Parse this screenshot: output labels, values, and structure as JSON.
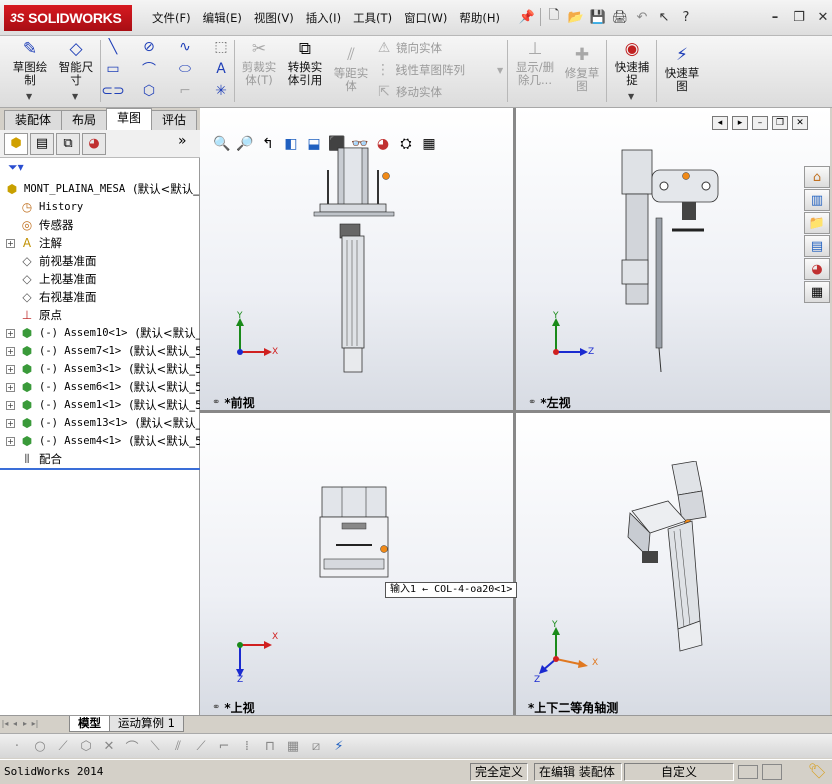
{
  "app": {
    "logo": "SOLIDWORKS",
    "logo_prefix": "3S"
  },
  "menu": [
    "文件(F)",
    "编辑(E)",
    "视图(V)",
    "插入(I)",
    "工具(T)",
    "窗口(W)",
    "帮助(H)"
  ],
  "toolbar": {
    "help_label": "?"
  },
  "command_manager": {
    "sketch": "草图绘\n制",
    "smart_dim": "智能尺\n寸",
    "trim": "剪裁实\n体(T)",
    "convert": "转换实\n体引用",
    "offset": "等距实\n体",
    "mirror": "镜向实体",
    "linear_pattern": "线性草图阵列",
    "move": "移动实体",
    "show_delete": "显示/删\n除几...",
    "repair": "修复草\n图",
    "quick_snap": "快速捕\n捉",
    "rapid_sketch": "快速草\n图"
  },
  "cm_tabs": [
    {
      "label": "装配体",
      "active": false
    },
    {
      "label": "布局",
      "active": false
    },
    {
      "label": "草图",
      "active": true
    },
    {
      "label": "评估",
      "active": false
    }
  ],
  "feature_tree": {
    "root": "MONT_PLAINA_MESA",
    "root_config": "(默认<默认_",
    "items": [
      {
        "label": "History",
        "icon": "history-icon",
        "expand": false,
        "mono": true
      },
      {
        "label": "传感器",
        "icon": "sensor-icon",
        "expand": false
      },
      {
        "label": "注解",
        "icon": "annotation-icon",
        "expand": true
      },
      {
        "label": "前视基准面",
        "icon": "plane-icon",
        "expand": false
      },
      {
        "label": "上视基准面",
        "icon": "plane-icon",
        "expand": false
      },
      {
        "label": "右视基准面",
        "icon": "plane-icon",
        "expand": false
      },
      {
        "label": "原点",
        "icon": "origin-icon",
        "expand": false
      },
      {
        "label": "(-) Assem10<1>",
        "config": "(默认<默认_",
        "icon": "assembly-icon",
        "expand": true,
        "mono": true
      },
      {
        "label": "(-) Assem7<1>",
        "config": "(默认<默认_5",
        "icon": "assembly-icon",
        "expand": true,
        "mono": true
      },
      {
        "label": "(-) Assem3<1>",
        "config": "(默认<默认_5",
        "icon": "assembly-icon",
        "expand": true,
        "mono": true
      },
      {
        "label": "(-) Assem6<1>",
        "config": "(默认<默认_5",
        "icon": "assembly-icon",
        "expand": true,
        "mono": true
      },
      {
        "label": "(-) Assem1<1>",
        "config": "(默认<默认_5",
        "icon": "assembly-icon",
        "expand": true,
        "mono": true
      },
      {
        "label": "(-) Assem13<1>",
        "config": "(默认<默认_",
        "icon": "assembly-icon",
        "expand": true,
        "mono": true
      },
      {
        "label": "(-) Assem4<1>",
        "config": "(默认<默认_5",
        "icon": "assembly-icon",
        "expand": true,
        "mono": true
      },
      {
        "label": "配合",
        "icon": "mates-icon",
        "expand": false
      }
    ]
  },
  "viewports": {
    "front": "*前视",
    "left": "*左视",
    "top": "*上视",
    "iso": "*上下二等角轴测"
  },
  "triad": {
    "x": "X",
    "y": "Y",
    "z": "Z"
  },
  "tooltip": "输入1 ← COL-4-oa20<1>",
  "model_tabs": [
    {
      "label": "模型",
      "active": true
    },
    {
      "label": "运动算例 1",
      "active": false
    }
  ],
  "status": {
    "app": "SolidWorks 2014",
    "definition": "完全定义",
    "editing": "在编辑 装配体",
    "units": "自定义"
  }
}
